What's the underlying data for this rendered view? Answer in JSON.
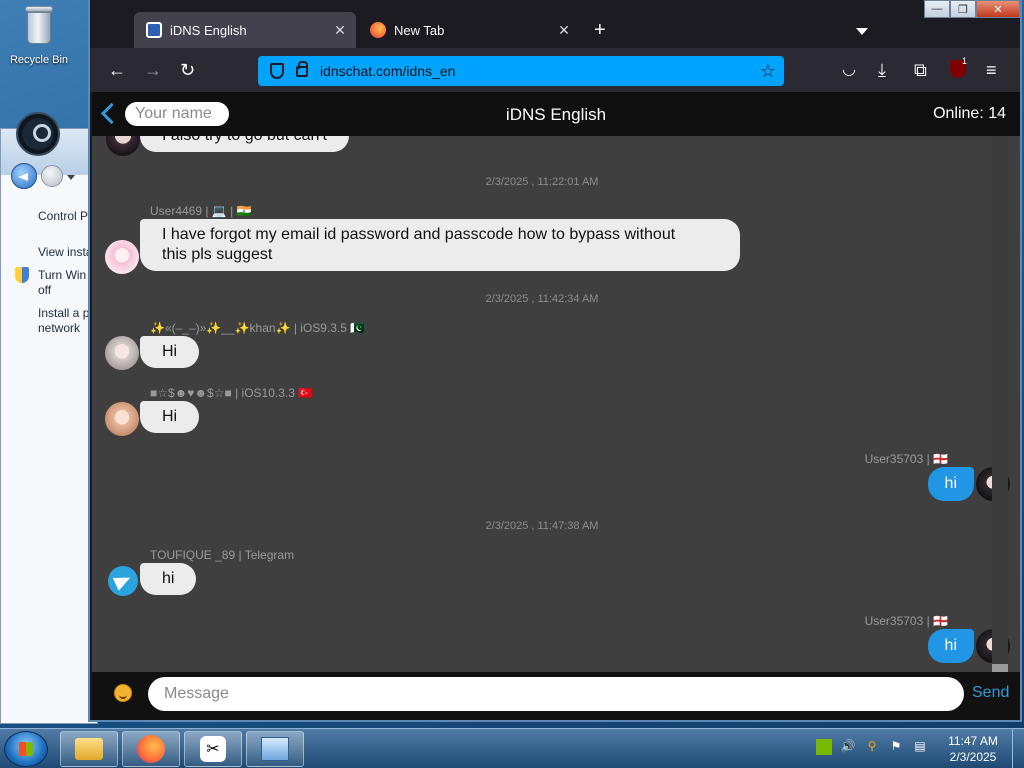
{
  "desktop": {
    "recycle_bin_label": "Recycle Bin",
    "control_panel": {
      "links": [
        "Control P",
        "View insta",
        "Turn Win",
        "off",
        "Install a p",
        "network"
      ]
    }
  },
  "browser": {
    "tabs": [
      {
        "title": "iDNS English",
        "active": true
      },
      {
        "title": "New Tab",
        "active": false
      }
    ],
    "url": "idnschat.com/idns_en",
    "ublock_badge": "1"
  },
  "chat": {
    "name_placeholder": "Your name",
    "title": "iDNS English",
    "online": "Online: 14",
    "partial_message": "I also try to go but can't",
    "messages": [
      {
        "timestamp": "2/3/2025 , 11:22:01 AM"
      },
      {
        "sender": "User4469 | 💻 | 🇮🇳",
        "text_line1": "I have forgot my email id password and passcode how to bypass without",
        "text_line2": "this pls suggest"
      },
      {
        "timestamp": "2/3/2025 , 11:42:34 AM"
      },
      {
        "sender": "✨«(–_–)»✨__✨khan✨ | iOS9.3.5 🇵🇰",
        "text": "Hi"
      },
      {
        "sender": "■☆$☻♥☻$☆■ | iOS10.3.3 🇹🇷",
        "text": "Hi"
      },
      {
        "sender": "User35703 | 🏴󠁧󠁢󠁥󠁮󠁧󠁿",
        "text": "hi",
        "mine": true
      },
      {
        "timestamp": "2/3/2025 , 11:47:38 AM"
      },
      {
        "sender": "TOUFIQUE _89 | Telegram",
        "text": "hi"
      },
      {
        "sender": "User35703 | 🏴󠁧󠁢󠁥󠁮󠁧󠁿",
        "text": "hi",
        "mine": true
      }
    ],
    "message_placeholder": "Message",
    "send_label": "Send"
  },
  "taskbar": {
    "time": "11:47 AM",
    "date": "2/3/2025",
    "capcut_glyph": "✂"
  },
  "colors": {
    "accent": "#00a4ff",
    "own_bubble": "#2196e4",
    "chat_bg": "#3f3f3f"
  }
}
